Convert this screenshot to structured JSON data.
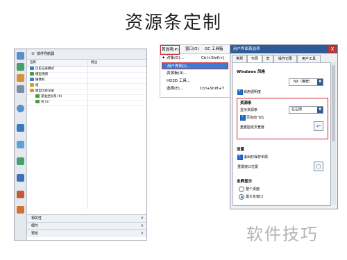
{
  "slide": {
    "title": "资源条定制",
    "watermark": "软件技巧"
  },
  "navigator": {
    "title": "部件导航器",
    "col_name": "名称",
    "col_attach": "附注",
    "tree": [
      {
        "label": "历史记录模式",
        "color": "#3a7bd5"
      },
      {
        "label": "模型视图",
        "color": "#4a9a3e"
      },
      {
        "label": "摄像机",
        "color": "#3a7bd5"
      },
      {
        "label": "组",
        "color": "#d59a2a"
      },
      {
        "label": "模型历史记录",
        "color": "#d59a2a"
      },
      {
        "label": "基准坐标系 (0)",
        "color": "#4a9a3e"
      },
      {
        "label": "块 (1)",
        "color": "#4a9a3e"
      }
    ],
    "panes": [
      {
        "label": "相关性"
      },
      {
        "label": "细节"
      },
      {
        "label": "预览"
      }
    ]
  },
  "menu": {
    "bar": {
      "prefs": "首选项(P)",
      "window": "窗口(O)",
      "gc": "GC 工具箱"
    },
    "items": [
      {
        "label": "对象(O)...",
        "shortcut": "Ctrl+Shift+J",
        "icon": "✦"
      },
      {
        "label": "用户界面(I)...",
        "shortcut": "",
        "icon": ""
      },
      {
        "label": "资源板(R)...",
        "shortcut": "",
        "icon": ""
      },
      {
        "label": "HD3D 工具...",
        "shortcut": "",
        "icon": ""
      },
      {
        "label": "选择(E)...",
        "shortcut": "Ctrl+Shift+T",
        "icon": ""
      }
    ]
  },
  "dialog": {
    "title": "用户界面首选项",
    "close": "X",
    "tabs": [
      "常规",
      "布局",
      "宏",
      "操作记录",
      "用户工具"
    ],
    "sections": {
      "windows_style": "Windows 风格",
      "resource_bar": "资源条",
      "settings": "设置",
      "fullscreen": "全屏显示"
    },
    "style_value": "NX（推荐）",
    "enable_transparency": "启用透明度",
    "show_resource_bar": "显示资源条",
    "show_resource_bar_value": "在左侧",
    "auto_flyout": "页自动飞出",
    "reset_pinned_width": "重置固定页宽度",
    "save_layout_on_exit": "退出时保存布局",
    "reset_window_position": "重置窗口位置",
    "fullscreen_options": [
      {
        "label": "整个桌面",
        "selected": false
      },
      {
        "label": "最大化窗口",
        "selected": true
      }
    ]
  },
  "colors": {
    "accent": "#1f6fd1",
    "highlight_red": "#d0202a",
    "titlebar": "#2e5b98"
  }
}
